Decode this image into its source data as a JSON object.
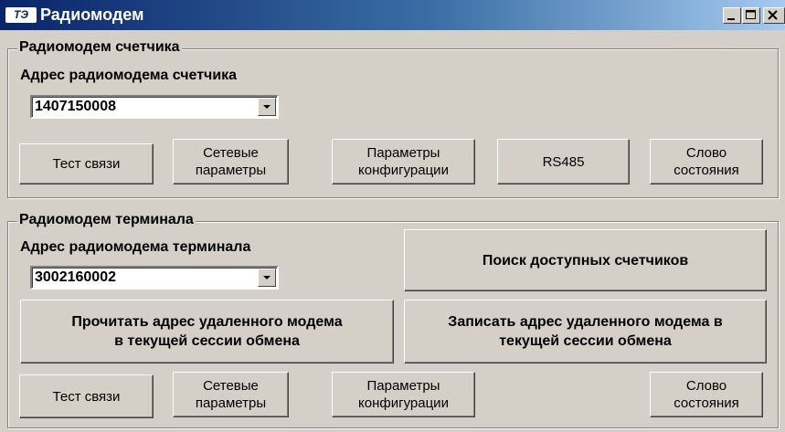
{
  "window": {
    "title": "Радиомодем",
    "icon_text": "ТЭ"
  },
  "meter_group": {
    "legend": "Радиомодем счетчика",
    "address_label": "Адрес радиомодема счетчика",
    "address_value": "1407150008",
    "buttons": {
      "test": "Тест связи",
      "network": "Сетевые\nпараметры",
      "config": "Параметры\nконфигурации",
      "rs485": "RS485",
      "status": "Слово\nсостояния"
    }
  },
  "terminal_group": {
    "legend": "Радиомодем терминала",
    "address_label": "Адрес радиомодема терминала",
    "address_value": "3002160002",
    "search": "Поиск доступных счетчиков",
    "read_remote": "Прочитать адрес удаленного модема\nв текущей сессии обмена",
    "write_remote": "Записать адрес удаленного  модема в\nтекущей сессии обмена",
    "buttons": {
      "test": "Тест связи",
      "network": "Сетевые\nпараметры",
      "config": "Параметры\nконфигурации",
      "status": "Слово\nсостояния"
    }
  },
  "icons": [
    "minimize-icon",
    "maximize-icon",
    "close-icon",
    "chevron-down-icon"
  ]
}
